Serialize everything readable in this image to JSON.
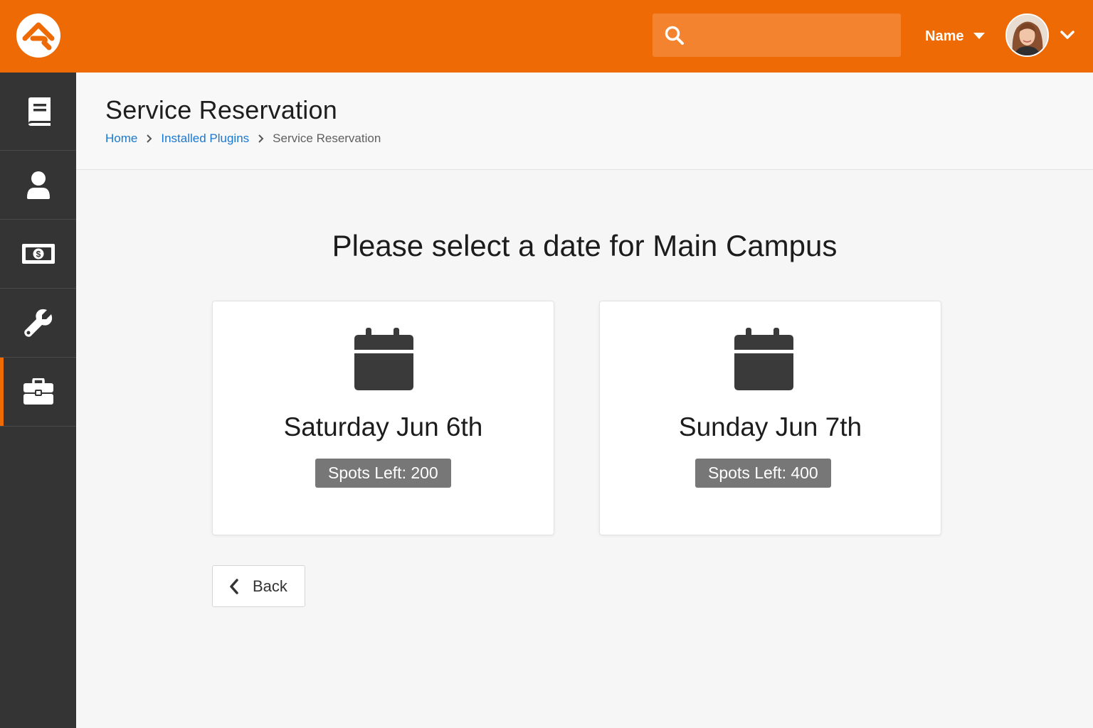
{
  "colors": {
    "brand": "#ee6a05",
    "sidebar": "#343434",
    "link": "#1b78d0",
    "badge": "#777777"
  },
  "header": {
    "search": {
      "placeholder": "",
      "icon": "search-icon"
    },
    "user": {
      "name": "Name",
      "avatar": "user-avatar"
    }
  },
  "sidebar": {
    "items": [
      {
        "icon": "book-icon",
        "active": false
      },
      {
        "icon": "person-icon",
        "active": false
      },
      {
        "icon": "money-icon",
        "active": false
      },
      {
        "icon": "wrench-icon",
        "active": false
      },
      {
        "icon": "briefcase-icon",
        "active": true
      }
    ]
  },
  "page": {
    "title": "Service Reservation",
    "breadcrumb": [
      {
        "label": "Home",
        "link": true
      },
      {
        "label": "Installed Plugins",
        "link": true
      },
      {
        "label": "Service Reservation",
        "link": false
      }
    ]
  },
  "main": {
    "prompt": "Please select a date for Main Campus",
    "dates": [
      {
        "label": "Saturday Jun 6th",
        "spots": "Spots Left: 200",
        "icon": "calendar-icon"
      },
      {
        "label": "Sunday Jun 7th",
        "spots": "Spots Left: 400",
        "icon": "calendar-icon"
      }
    ],
    "back_label": "Back"
  }
}
